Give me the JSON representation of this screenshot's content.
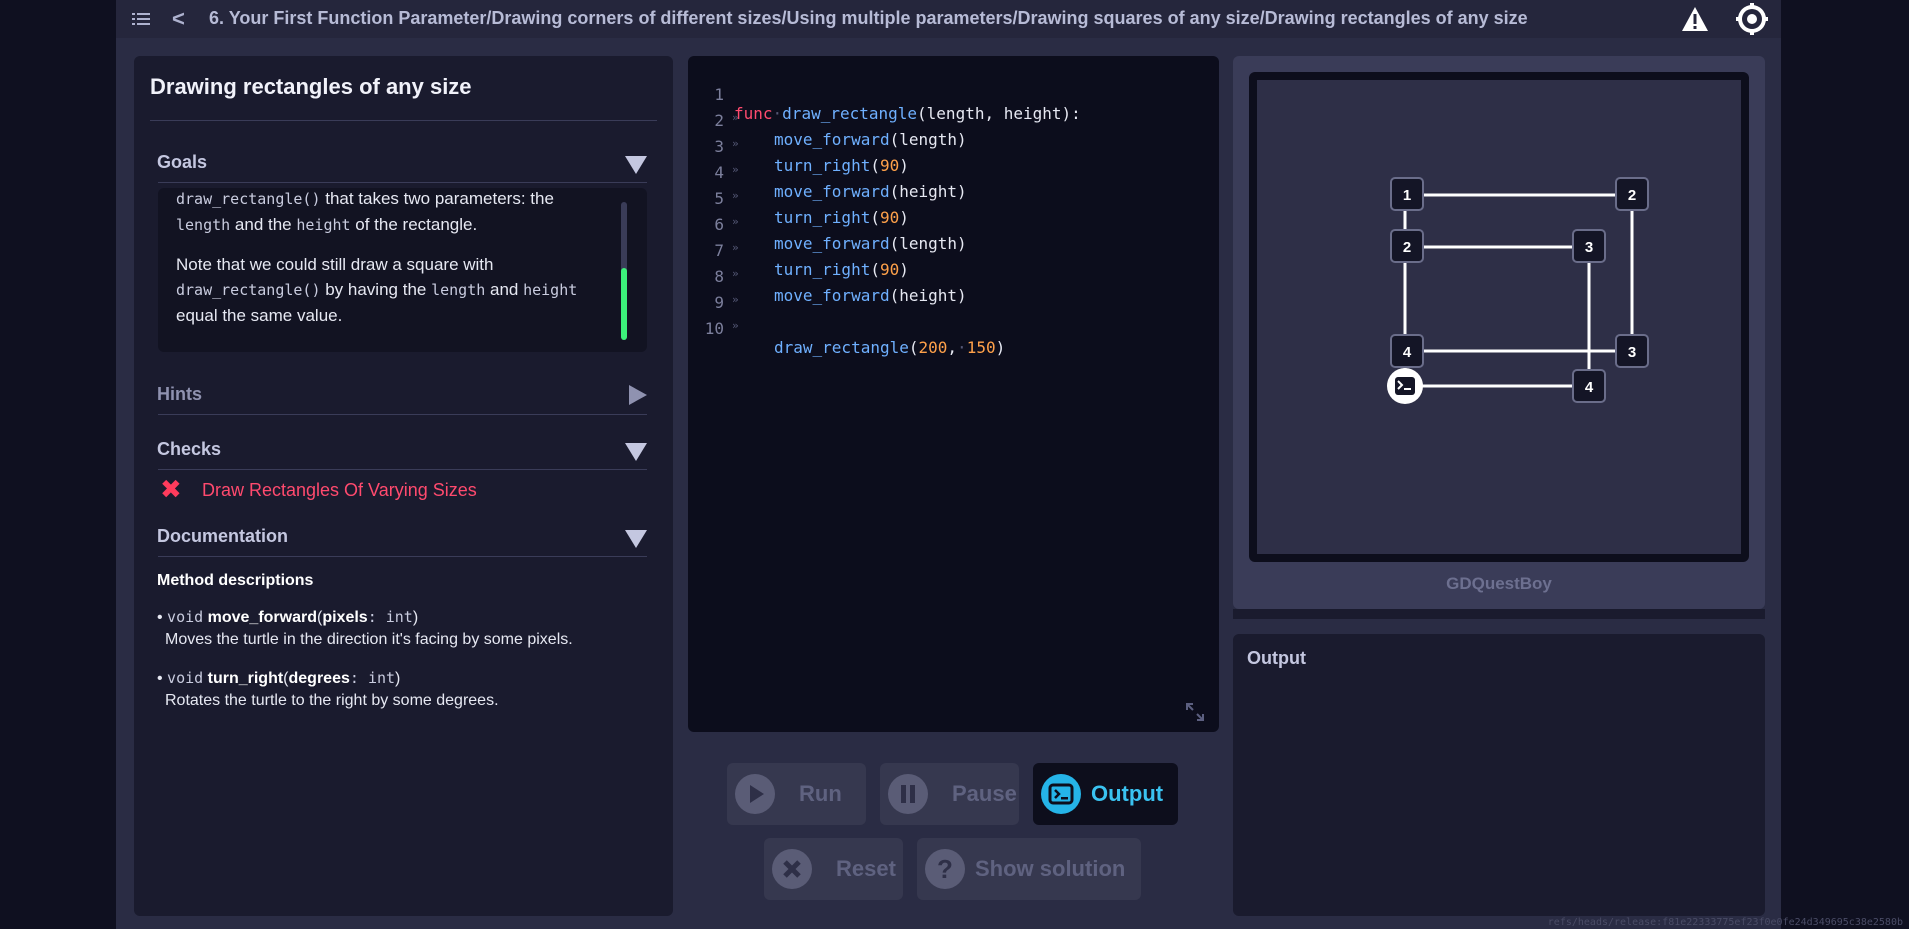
{
  "topbar": {
    "breadcrumb": "6. Your First Function Parameter/Drawing corners of different sizes/Using multiple parameters/Drawing squares of any size/Drawing rectangles of any size"
  },
  "lesson": {
    "title": "Drawing rectangles of any size",
    "goals_label": "Goals",
    "goals_text": {
      "p1_code": "draw_rectangle()",
      "p1_text": " that takes two parameters: the",
      "p1_code2": "length",
      "p1_mid": " and the ",
      "p1_code3": "height",
      "p1_end": " of the rectangle.",
      "p2_start": "Note that we could still draw a square with",
      "p2_code": "draw_rectangle()",
      "p2_mid": " by having the ",
      "p2_code2": "length",
      "p2_and": " and ",
      "p2_code3": "height",
      "p2_end": " equal the same value."
    },
    "hints_label": "Hints",
    "checks_label": "Checks",
    "check_item": "Draw Rectangles Of Varying Sizes",
    "documentation_label": "Documentation",
    "method_descriptions": "Method descriptions",
    "methods": [
      {
        "ret": "void",
        "name": "move_forward",
        "param": "pixels",
        "type": "int",
        "desc": "Moves the turtle in the direction it's facing by some pixels."
      },
      {
        "ret": "void",
        "name": "turn_right",
        "param": "degrees",
        "type": "int",
        "desc": "Rotates the turtle to the right by some degrees."
      }
    ]
  },
  "editor": {
    "lines": [
      {
        "n": "1",
        "kw": "func",
        "fn": "draw_rectangle",
        "rest": "(length, height):"
      },
      {
        "n": "2",
        "fn": "move_forward",
        "rest": "(length)"
      },
      {
        "n": "3",
        "fn": "turn_right",
        "arg": "90"
      },
      {
        "n": "4",
        "fn": "move_forward",
        "rest": "(height)"
      },
      {
        "n": "5",
        "fn": "turn_right",
        "arg": "90"
      },
      {
        "n": "6",
        "fn": "move_forward",
        "rest": "(length)"
      },
      {
        "n": "7",
        "fn": "turn_right",
        "arg": "90"
      },
      {
        "n": "8",
        "fn": "move_forward",
        "rest": "(height)"
      },
      {
        "n": "9"
      },
      {
        "n": "10",
        "fn": "draw_rectangle",
        "a1": "200",
        "a2": "150"
      }
    ]
  },
  "controls": {
    "run": "Run",
    "pause": "Pause",
    "output": "Output",
    "reset": "Reset",
    "show_solution": "Show solution"
  },
  "canvas": {
    "bot_name": "GDQuestBoy",
    "markers": [
      "1",
      "2",
      "2",
      "3",
      "3",
      "4",
      "4"
    ]
  },
  "output_panel": {
    "title": "Output"
  },
  "footer": {
    "ref": "refs/heads/release:f81e22333775ef23f0e0fe24d349695c38e2580b"
  },
  "colors": {
    "accent": "#3ac2f0",
    "error": "#ff4a6e",
    "success": "#3cf07a"
  }
}
